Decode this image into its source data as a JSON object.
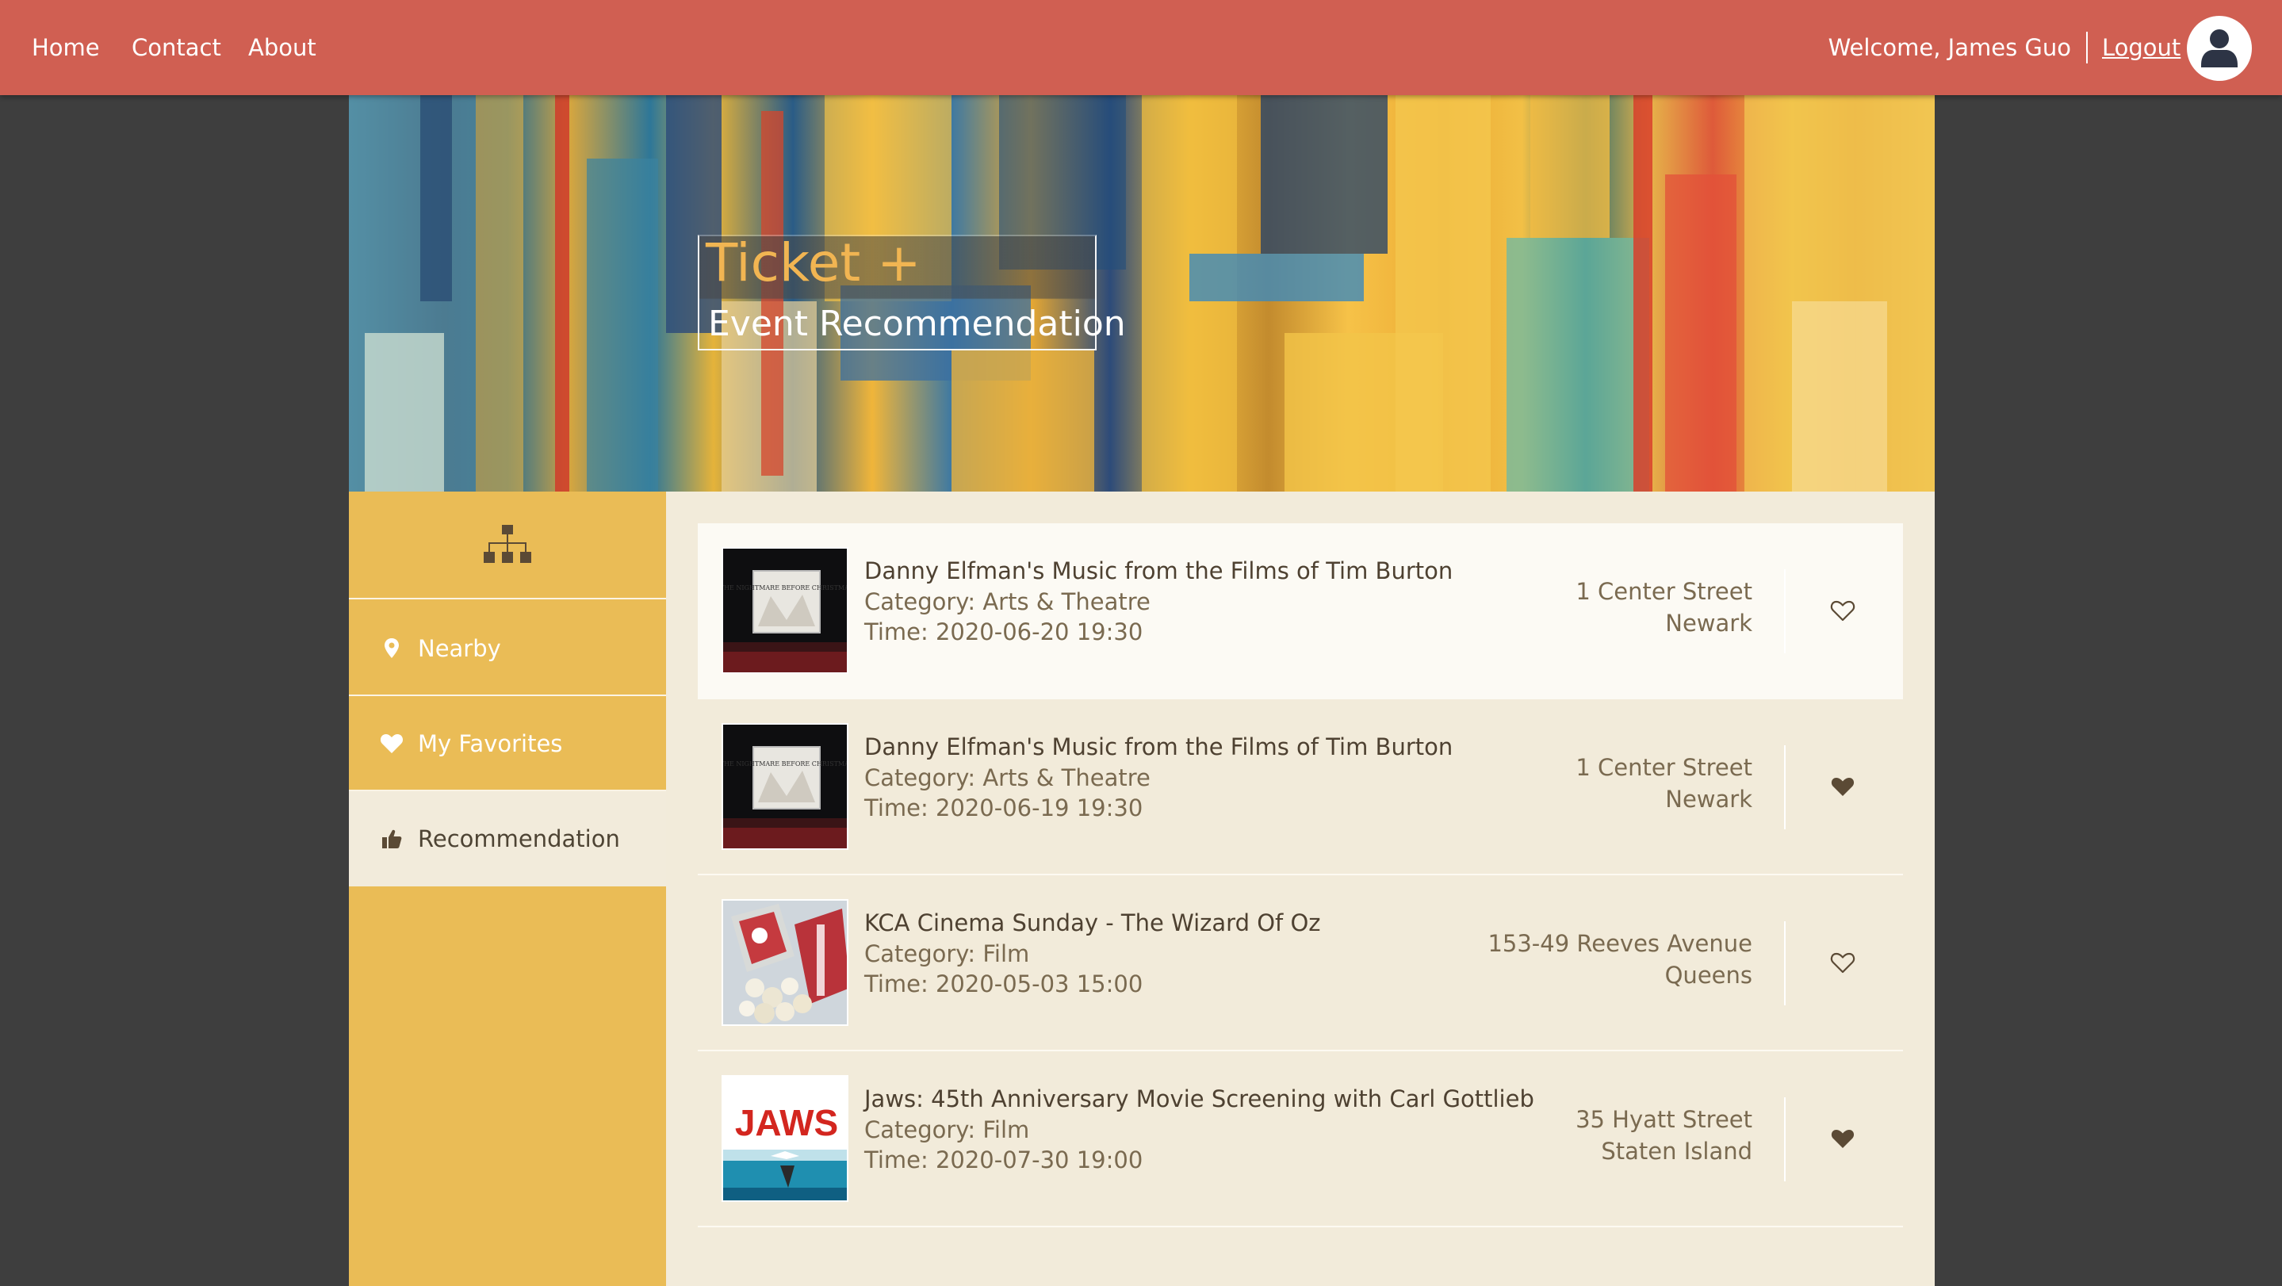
{
  "nav": {
    "links": [
      "Home",
      "Contact",
      "About"
    ],
    "welcome": "Welcome, James Guo",
    "logout": "Logout"
  },
  "banner": {
    "title": "Ticket +",
    "subtitle": "Event Recommendation"
  },
  "sidebar": {
    "items": [
      {
        "label": "Nearby",
        "icon": "map-pin-icon"
      },
      {
        "label": "My Favorites",
        "icon": "heart-icon"
      },
      {
        "label": "Recommendation",
        "icon": "thumbs-up-icon",
        "active": true
      }
    ]
  },
  "events": [
    {
      "name": "Danny Elfman's Music from the Films of Tim Burton",
      "category": "Category: Arts & Theatre",
      "time": "Time: 2020-06-20 19:30",
      "street": "1 Center Street",
      "city": "Newark",
      "favorited": false
    },
    {
      "name": "Danny Elfman's Music from the Films of Tim Burton",
      "category": "Category: Arts & Theatre",
      "time": "Time: 2020-06-19 19:30",
      "street": "1 Center Street",
      "city": "Newark",
      "favorited": true
    },
    {
      "name": "KCA Cinema Sunday - The Wizard Of Oz",
      "category": "Category: Film",
      "time": "Time: 2020-05-03 15:00",
      "street": "153-49 Reeves Avenue",
      "city": "Queens",
      "favorited": false
    },
    {
      "name": "Jaws: 45th Anniversary Movie Screening with Carl Gottlieb",
      "category": "Category: Film",
      "time": "Time: 2020-07-30 19:00",
      "street": "35 Hyatt Street",
      "city": "Staten Island",
      "favorited": true
    }
  ],
  "thumb_text": {
    "nightmare": "THE NIGHTMARE BEFORE CHRISTMAS",
    "jaws": "JAWS"
  },
  "colors": {
    "nav_bg": "#d05f52",
    "sidebar_bg": "#eabc56",
    "main_bg": "#f2ebda",
    "title_accent": "#f1b552",
    "text_dark": "#4e4131"
  }
}
